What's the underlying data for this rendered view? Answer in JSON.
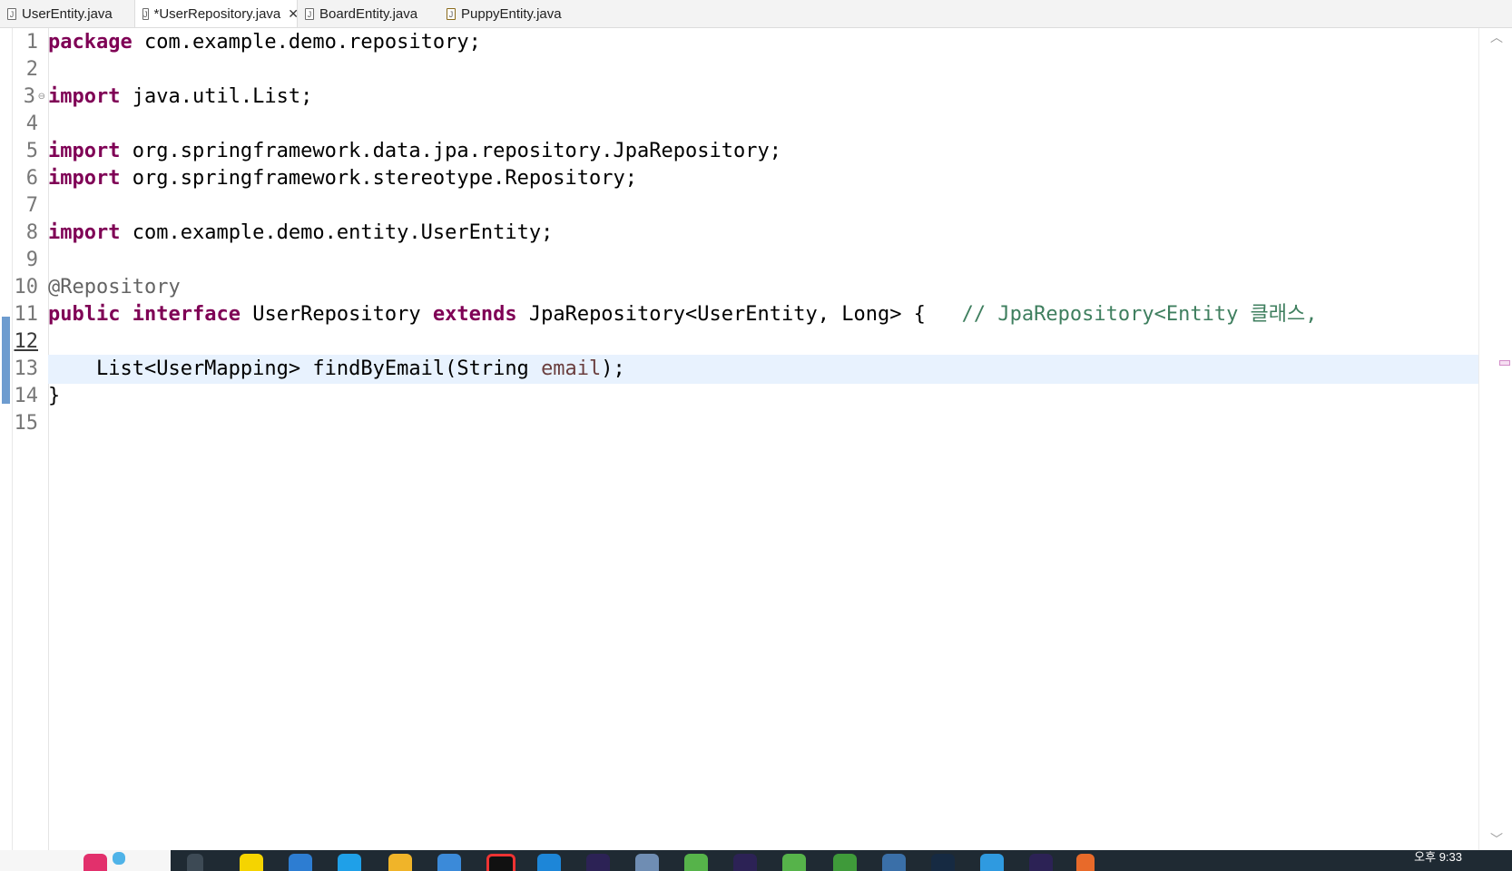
{
  "tabs": [
    {
      "label": "UserEntity.java",
      "active": false,
      "dirty": false
    },
    {
      "label": "*UserRepository.java",
      "active": true,
      "dirty": true
    },
    {
      "label": "BoardEntity.java",
      "active": false,
      "dirty": false
    },
    {
      "label": "PuppyEntity.java",
      "active": false,
      "dirty": false
    }
  ],
  "editor": {
    "line_numbers": [
      "1",
      "2",
      "3",
      "4",
      "5",
      "6",
      "7",
      "8",
      "9",
      "10",
      "11",
      "12",
      "13",
      "14",
      "15"
    ],
    "current_line": "12",
    "code": {
      "l1_kw": "package",
      "l1_rest": " com.example.demo.repository;",
      "l3_kw": "import",
      "l3_rest": " java.util.List;",
      "l5_kw": "import",
      "l5_rest": " org.springframework.data.jpa.repository.JpaRepository;",
      "l6_kw": "import",
      "l6_rest": " org.springframework.stereotype.Repository;",
      "l8_kw": "import",
      "l8_rest": " com.example.demo.entity.UserEntity;",
      "l10_ann": "@Repository",
      "l11_kw1": "public",
      "l11_kw2": "interface",
      "l11_name": " UserRepository ",
      "l11_kw3": "extends",
      "l11_rest": " JpaRepository<UserEntity, Long> {   ",
      "l11_comment": "// JpaRepository<Entity 클래스,",
      "l13_pre": "    List<UserMapping> findByEmail(String ",
      "l13_var": "email",
      "l13_post": ");",
      "l14": "}"
    }
  },
  "taskbar": {
    "clock_line1": "오후 9:33"
  },
  "colors": {
    "keyword": "#7f0055",
    "annotation": "#646464",
    "comment": "#3f7f5f",
    "variable": "#6a3e3e",
    "current_line_bg": "#e8f2fe"
  }
}
